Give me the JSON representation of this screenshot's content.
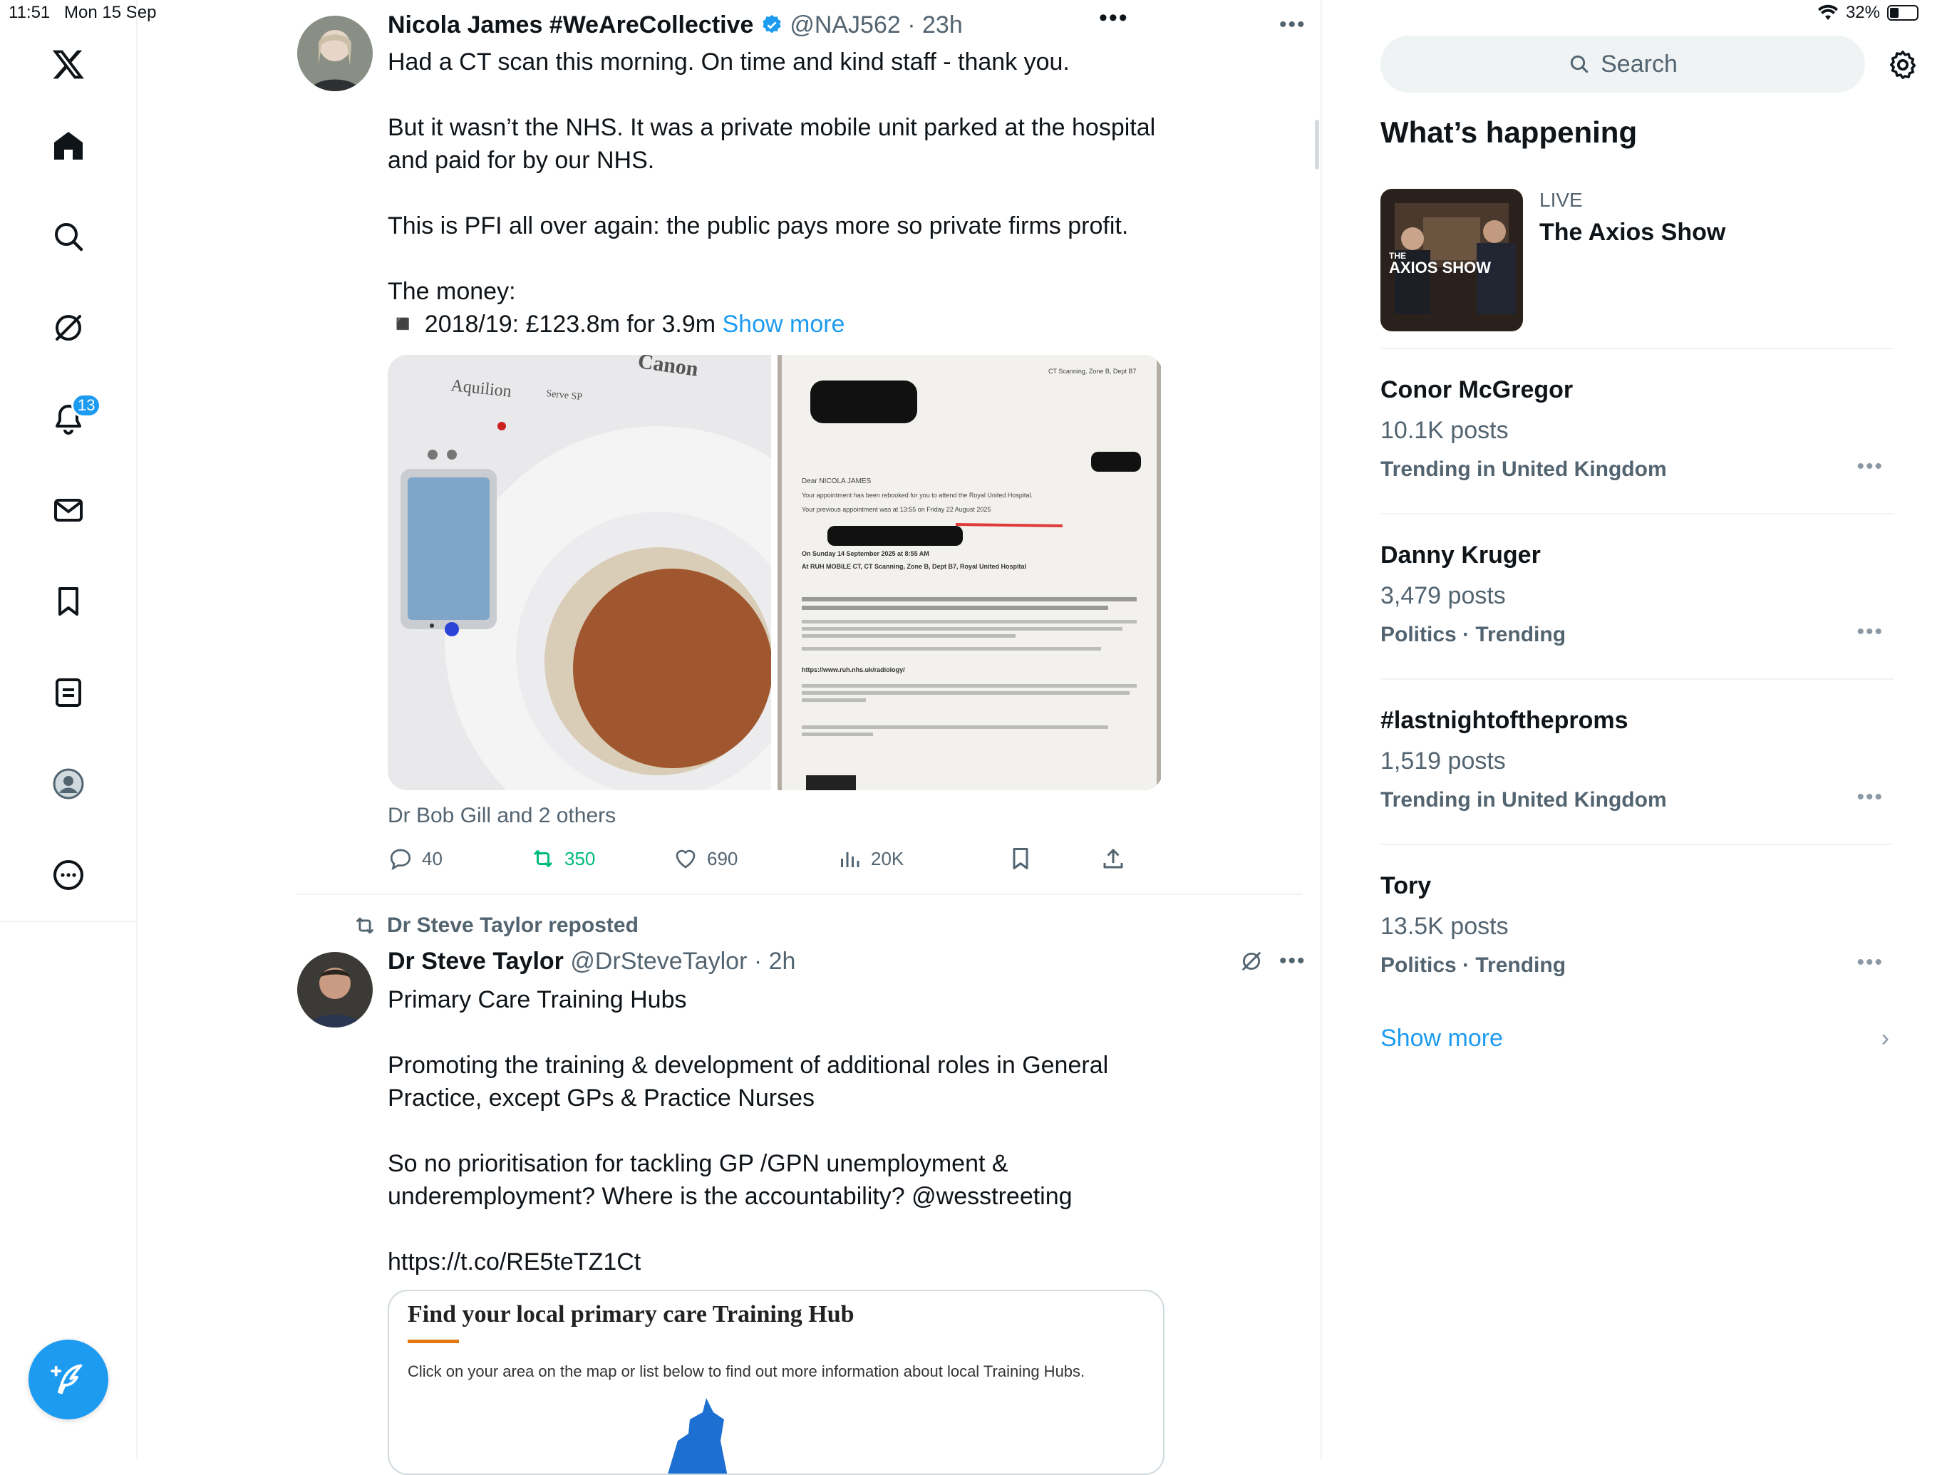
{
  "status_bar": {
    "time": "11:51",
    "date": "Mon 15 Sep",
    "battery": "32%",
    "battery_level": 0.32
  },
  "nav": {
    "notifications_count": "13"
  },
  "tweets": [
    {
      "name": "Nicola James #WeAreCollective",
      "handle": "@NAJ562",
      "time": "23h",
      "paragraphs": [
        "Had a CT scan this morning. On time and kind staff - thank you.",
        "But it wasn’t the NHS. It was a private mobile unit parked at the hospital and paid for by our NHS.",
        "This is PFI all over again: the public pays more so private firms profit."
      ],
      "money_label": "The money:",
      "money_line": "◾️ 2018/19: £123.8m for 3.9m",
      "show_more": "Show more",
      "image1_brand": "Canon",
      "image1_model": "Aquilion",
      "image1_model_suffix": "Serve SP",
      "letter_header": "CT Scanning, Zone B, Dept B7",
      "letter_greeting": "Dear NICOLA JAMES",
      "letter_line1": "Your appointment has been rebooked for you to attend the Royal United Hospital.",
      "letter_line2": "Your previous appointment was at 13:55 on Friday 22 August 2025",
      "letter_on": "On  Sunday 14 September 2025 at 8:55 AM",
      "letter_at": "At  RUH MOBILE CT, CT Scanning, Zone B, Dept B7, Royal United Hospital",
      "letter_url": "https://www.ruh.nhs.uk/radiology/",
      "reposted_by": "Dr Bob Gill and 2 others",
      "replies": "40",
      "reposts": "350",
      "likes": "690",
      "views": "20K"
    },
    {
      "repost_label": "Dr Steve Taylor reposted",
      "name": "Dr Steve Taylor",
      "handle": "@DrSteveTaylor",
      "time": "2h",
      "paragraphs": [
        "Primary Care Training Hubs",
        "Promoting the training & development of additional roles in General Practice, except GPs & Practice Nurses",
        "So no prioritisation for tackling GP /GPN unemployment & underemployment? Where is the accountability? @wesstreeting",
        "https://t.co/RE5teTZ1Ct"
      ],
      "card_title": "Find your local primary care Training Hub",
      "card_text": "Click on your area on the map or list below to find out more information about local Training Hubs."
    }
  ],
  "sidebar": {
    "search_placeholder": "Search",
    "section_title": "What’s happening",
    "live": {
      "label": "LIVE",
      "title": "The Axios Show",
      "thumb_text": "AXIOS SHOW",
      "thumb_prefix": "THE"
    },
    "trends": [
      {
        "name": "Conor McGregor",
        "posts": "10.1K posts",
        "context": "Trending in United Kingdom"
      },
      {
        "name": "Danny Kruger",
        "posts": "3,479 posts",
        "context": "Politics · Trending"
      },
      {
        "name": "#lastnightoftheproms",
        "posts": "1,519 posts",
        "context": "Trending in United Kingdom"
      },
      {
        "name": "Tory",
        "posts": "13.5K posts",
        "context": "Politics · Trending"
      }
    ],
    "show_more": "Show more"
  },
  "colors": {
    "accent": "#1d9bf0",
    "repost_green": "#00ba7c",
    "muted": "#536471",
    "border": "#eff3f4"
  }
}
